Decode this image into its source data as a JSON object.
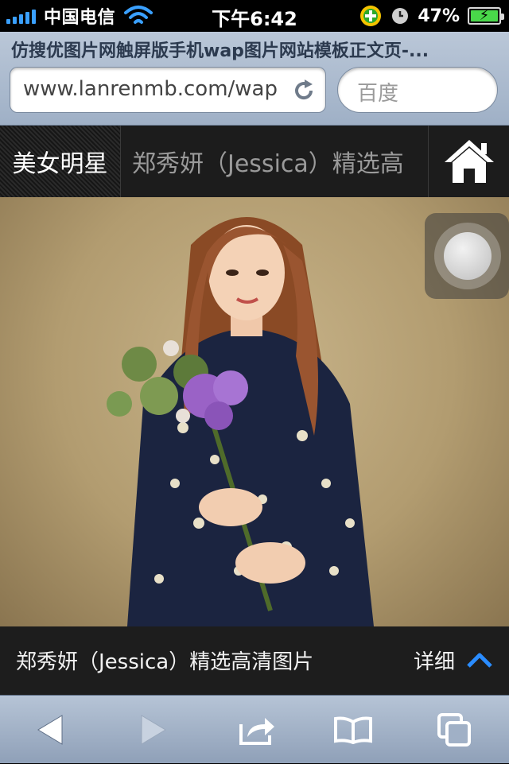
{
  "status_bar": {
    "carrier": "中国电信",
    "time": "下午6:42",
    "battery_percent": "47%"
  },
  "browser": {
    "page_title": "仿搜优图片网触屏版手机wap图片网站模板正文页-...",
    "url": "www.lanrenmb.com/wap",
    "search_placeholder": "百度"
  },
  "site_nav": {
    "category": "美女明星",
    "article_title": "郑秀妍（Jessica）精选高",
    "home_icon": "home-icon"
  },
  "photo": {
    "subject": "person-holding-flowers-photo"
  },
  "caption": {
    "title": "郑秀妍（Jessica）精选高清图片",
    "detail_label": "详细",
    "detail_icon": "chevron-up-icon"
  },
  "toolbar": {
    "icons": [
      "back-icon",
      "forward-icon",
      "share-icon",
      "bookmarks-icon",
      "tabs-icon"
    ]
  },
  "colors": {
    "accent_blue": "#2a8cff",
    "nav_bg": "#1c1c1c",
    "caption_bg": "#1d1d1d"
  }
}
